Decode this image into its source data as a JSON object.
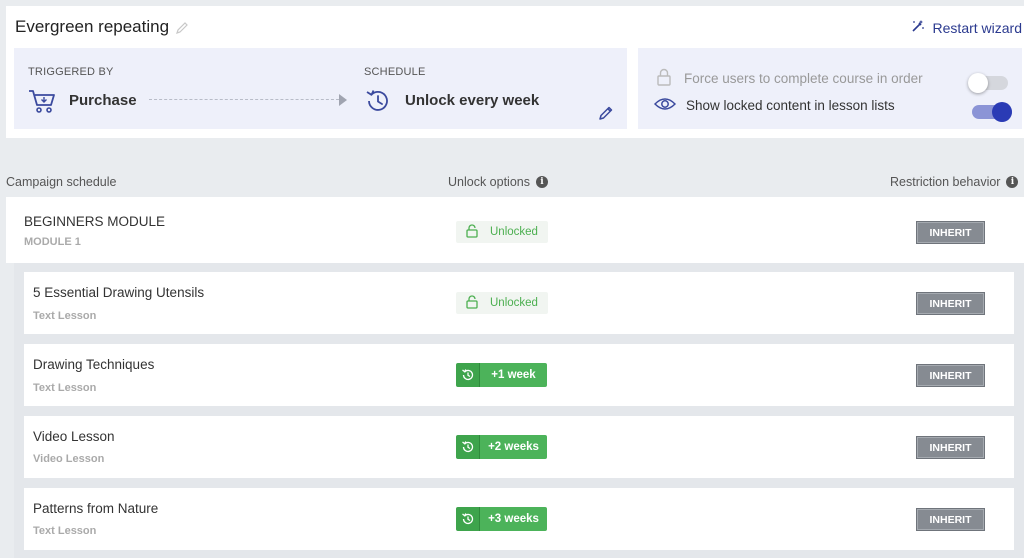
{
  "header": {
    "title": "Evergreen repeating",
    "restart_label": "Restart wizard"
  },
  "trigger": {
    "triggered_by_label": "TRIGGERED BY",
    "triggered_by_value": "Purchase",
    "schedule_label": "SCHEDULE",
    "schedule_value": "Unlock every week"
  },
  "options": {
    "force_order": {
      "label": "Force users to complete course in order",
      "enabled": false
    },
    "show_locked": {
      "label": "Show locked content in lesson lists",
      "enabled": true
    }
  },
  "columns": {
    "schedule": "Campaign schedule",
    "unlock": "Unlock options",
    "restriction": "Restriction behavior"
  },
  "module": {
    "title": "BEGINNERS MODULE",
    "subtitle": "MODULE 1",
    "unlock": "Unlocked",
    "restriction": "INHERIT"
  },
  "lessons": [
    {
      "title": "5 Essential Drawing Utensils",
      "type": "Text Lesson",
      "unlock": "Unlocked",
      "restriction": "INHERIT"
    },
    {
      "title": "Drawing Techniques",
      "type": "Text Lesson",
      "unlock": "+1 week",
      "restriction": "INHERIT"
    },
    {
      "title": "Video Lesson",
      "type": "Video Lesson",
      "unlock": "+2 weeks",
      "restriction": "INHERIT"
    },
    {
      "title": "Patterns from Nature",
      "type": "Text Lesson",
      "unlock": "+3 weeks",
      "restriction": "INHERIT"
    }
  ],
  "colors": {
    "accent": "#2a3bb5",
    "unlock_green": "#4cb35a",
    "inherit_gray": "#868b92"
  }
}
